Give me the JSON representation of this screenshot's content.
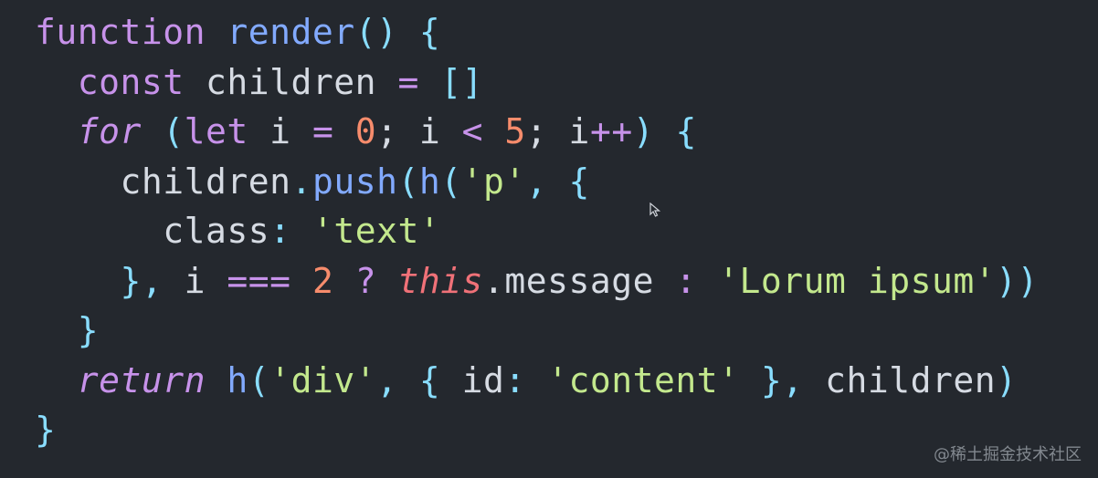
{
  "code_lines": [
    [
      {
        "t": "function",
        "c": "kw"
      },
      {
        "t": " ",
        "c": "plain"
      },
      {
        "t": "render",
        "c": "fn"
      },
      {
        "t": "()",
        "c": "pun"
      },
      {
        "t": " {",
        "c": "pun"
      }
    ],
    [
      {
        "t": "  const",
        "c": "kw"
      },
      {
        "t": " children ",
        "c": "id"
      },
      {
        "t": "=",
        "c": "op"
      },
      {
        "t": " []",
        "c": "pun"
      }
    ],
    [
      {
        "t": "  for",
        "c": "kwi"
      },
      {
        "t": " (",
        "c": "pun"
      },
      {
        "t": "let",
        "c": "kw"
      },
      {
        "t": " i ",
        "c": "id"
      },
      {
        "t": "=",
        "c": "op"
      },
      {
        "t": " ",
        "c": "plain"
      },
      {
        "t": "0",
        "c": "num"
      },
      {
        "t": "; i ",
        "c": "id"
      },
      {
        "t": "<",
        "c": "op"
      },
      {
        "t": " ",
        "c": "plain"
      },
      {
        "t": "5",
        "c": "num"
      },
      {
        "t": "; i",
        "c": "id"
      },
      {
        "t": "++",
        "c": "op"
      },
      {
        "t": ") {",
        "c": "pun"
      }
    ],
    [
      {
        "t": "    children",
        "c": "id"
      },
      {
        "t": ".",
        "c": "pun"
      },
      {
        "t": "push",
        "c": "fn"
      },
      {
        "t": "(",
        "c": "pun"
      },
      {
        "t": "h",
        "c": "fn"
      },
      {
        "t": "(",
        "c": "pun"
      },
      {
        "t": "'p'",
        "c": "str"
      },
      {
        "t": ", {",
        "c": "pun"
      }
    ],
    [
      {
        "t": "      class",
        "c": "id"
      },
      {
        "t": ": ",
        "c": "pun"
      },
      {
        "t": "'text'",
        "c": "str"
      }
    ],
    [
      {
        "t": "    }, ",
        "c": "pun"
      },
      {
        "t": "i ",
        "c": "id"
      },
      {
        "t": "===",
        "c": "op"
      },
      {
        "t": " ",
        "c": "plain"
      },
      {
        "t": "2",
        "c": "num"
      },
      {
        "t": " ? ",
        "c": "op"
      },
      {
        "t": "this",
        "c": "this"
      },
      {
        "t": ".message",
        "c": "id"
      },
      {
        "t": " : ",
        "c": "op"
      },
      {
        "t": "'Lorum ipsum'",
        "c": "str"
      },
      {
        "t": "))",
        "c": "pun"
      }
    ],
    [
      {
        "t": "  }",
        "c": "pun"
      }
    ],
    [
      {
        "t": "  return",
        "c": "kwi"
      },
      {
        "t": " ",
        "c": "plain"
      },
      {
        "t": "h",
        "c": "fn"
      },
      {
        "t": "(",
        "c": "pun"
      },
      {
        "t": "'div'",
        "c": "str"
      },
      {
        "t": ", { ",
        "c": "pun"
      },
      {
        "t": "id",
        "c": "id"
      },
      {
        "t": ": ",
        "c": "pun"
      },
      {
        "t": "'content'",
        "c": "str"
      },
      {
        "t": " }, ",
        "c": "pun"
      },
      {
        "t": "children",
        "c": "id"
      },
      {
        "t": ")",
        "c": "pun"
      }
    ],
    [
      {
        "t": "}",
        "c": "pun"
      }
    ]
  ],
  "watermark": "@稀土掘金技术社区",
  "icons": {
    "pointer": "mouse-pointer-icon"
  },
  "colors": {
    "background": "#24282e",
    "keyword": "#c792ea",
    "function": "#82aaff",
    "string": "#c3e88d",
    "number": "#f78c6c",
    "this": "#f07178"
  }
}
